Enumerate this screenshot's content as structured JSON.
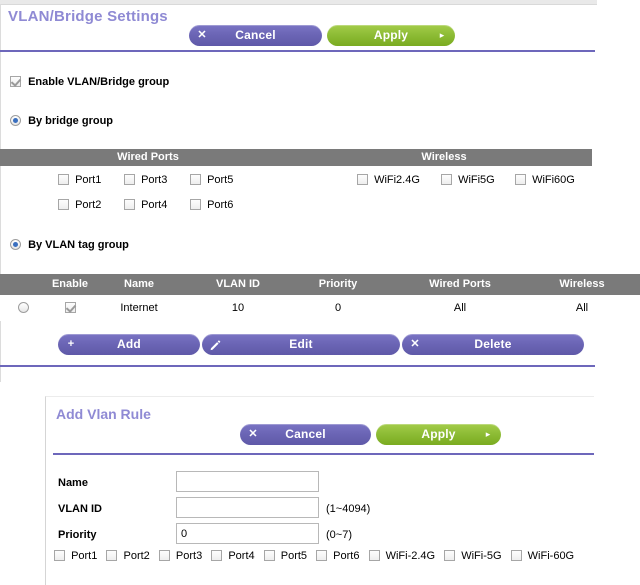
{
  "page": {
    "title": "VLAN/Bridge Settings"
  },
  "header_actions": {
    "cancel": {
      "label": "Cancel",
      "icon": "close-icon",
      "glyph": "✕"
    },
    "apply": {
      "label": "Apply",
      "icon": "arrow-right-icon",
      "glyph": "▸"
    }
  },
  "enable_group": {
    "label": "Enable VLAN/Bridge group",
    "checked": true
  },
  "mode_options": [
    {
      "label": "By bridge group",
      "selected": true
    },
    {
      "label": "By VLAN tag group",
      "selected": true
    }
  ],
  "bridge_group": {
    "headers": {
      "wired": "Wired Ports",
      "wireless": "Wireless"
    },
    "wired_ports": [
      {
        "label": "Port1",
        "checked": false
      },
      {
        "label": "Port3",
        "checked": false
      },
      {
        "label": "Port5",
        "checked": false
      },
      {
        "label": "Port2",
        "checked": false
      },
      {
        "label": "Port4",
        "checked": false
      },
      {
        "label": "Port6",
        "checked": false
      }
    ],
    "wireless": [
      {
        "label": "WiFi2.4G",
        "checked": false
      },
      {
        "label": "WiFi5G",
        "checked": false
      },
      {
        "label": "WiFi60G",
        "checked": false
      }
    ]
  },
  "vlan_table": {
    "columns": [
      "Enable",
      "Name",
      "VLAN ID",
      "Priority",
      "Wired Ports",
      "Wireless"
    ],
    "rows": [
      {
        "selected": false,
        "enable": true,
        "name": "Internet",
        "vlan_id": "10",
        "priority": "0",
        "wired_ports": "All",
        "wireless": "All"
      }
    ],
    "actions": [
      {
        "label": "Add",
        "icon": "plus-icon",
        "glyph": "+"
      },
      {
        "label": "Edit",
        "icon": "pencil-icon",
        "glyph": "✎"
      },
      {
        "label": "Delete",
        "icon": "close-icon",
        "glyph": "✕"
      }
    ]
  },
  "add_rule_panel": {
    "title": "Add Vlan Rule",
    "cancel": {
      "label": "Cancel",
      "icon": "close-icon",
      "glyph": "✕"
    },
    "apply": {
      "label": "Apply",
      "icon": "arrow-right-icon",
      "glyph": "▸"
    },
    "fields": {
      "name": {
        "label": "Name",
        "value": "",
        "placeholder": "",
        "hint": ""
      },
      "vlan_id": {
        "label": "VLAN ID",
        "value": "",
        "placeholder": "",
        "hint": "(1~4094)"
      },
      "priority": {
        "label": "Priority",
        "value": "0",
        "placeholder": "",
        "hint": "(0~7)"
      }
    },
    "checkboxes": [
      {
        "label": "Port1",
        "checked": false
      },
      {
        "label": "Port2",
        "checked": false
      },
      {
        "label": "Port3",
        "checked": false
      },
      {
        "label": "Port4",
        "checked": false
      },
      {
        "label": "Port5",
        "checked": false
      },
      {
        "label": "Port6",
        "checked": false
      },
      {
        "label": "WiFi-2.4G",
        "checked": false
      },
      {
        "label": "WiFi-5G",
        "checked": false
      },
      {
        "label": "WiFi-60G",
        "checked": false
      }
    ]
  },
  "colors": {
    "accent_purple": "#6d67bb",
    "title_purple": "#8f8ad4",
    "apply_green": "#8cbb34",
    "table_header_gray": "#7a7a7a"
  }
}
